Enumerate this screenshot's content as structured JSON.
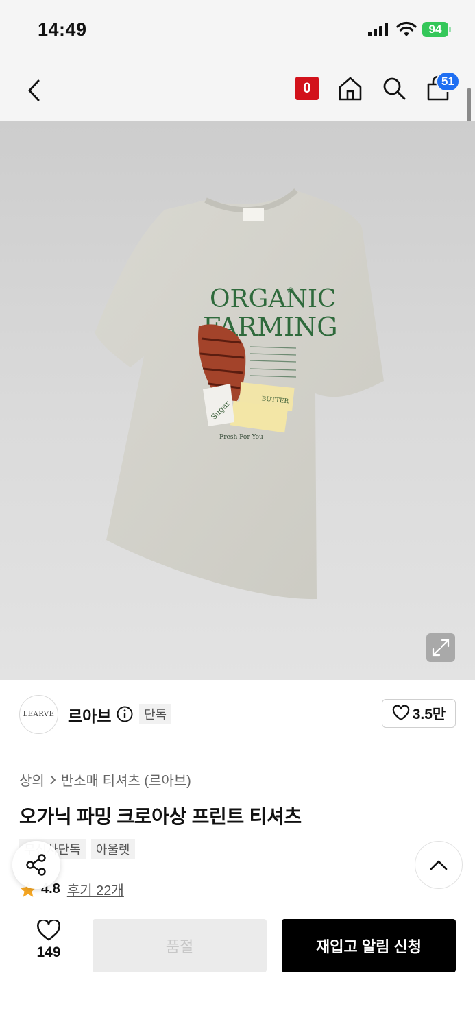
{
  "status_bar": {
    "time": "14:49",
    "battery": "94"
  },
  "nav": {
    "brand_badge": "0",
    "cart_count": "51",
    "icons": [
      "back-icon",
      "home-icon",
      "search-icon",
      "cart-icon"
    ]
  },
  "product_image": {
    "print_line1": "ORGANIC",
    "print_line2": "FARMING",
    "print_reg": "®",
    "butter_label": "BUTTER",
    "sugar_label": "Sugar",
    "caption": "Fresh For You"
  },
  "brand": {
    "logo_text": "LEARVE",
    "name": "르아브",
    "exclusive_tag": "단독",
    "likes": "3.5만"
  },
  "breadcrumb": {
    "category": "상의",
    "subcategory": "반소매 티셔츠 (르아브)"
  },
  "product": {
    "title": "오가닉 파밍 크로아상 프린트 티셔츠",
    "tags": [
      "무신사단독",
      "아울렛"
    ],
    "rating": "4.8",
    "reviews": "후기 22개"
  },
  "bottom_bar": {
    "wish_count": "149",
    "soldout_label": "품절",
    "restock_label": "재입고 알림 신청"
  },
  "colors": {
    "accent_blue": "#1f6ff2",
    "brand_red": "#d2121b",
    "battery_green": "#34c759",
    "star": "#f5a623"
  }
}
